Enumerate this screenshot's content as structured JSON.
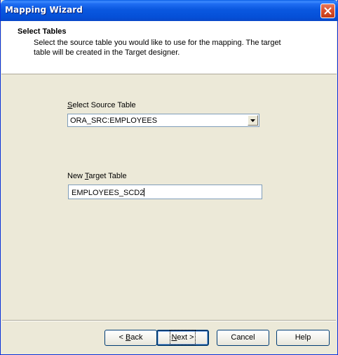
{
  "window": {
    "title": "Mapping Wizard"
  },
  "header": {
    "title": "Select Tables",
    "description": "Select the source table you would like to use for the mapping. The target table will be created in the Target designer."
  },
  "source": {
    "label_mnemonic": "S",
    "label_rest": "elect Source Table",
    "value": "ORA_SRC:EMPLOYEES"
  },
  "target": {
    "label_pre": "New ",
    "label_mnemonic": "T",
    "label_rest": "arget Table",
    "value": "EMPLOYEES_SCD2"
  },
  "buttons": {
    "back_pre": "< ",
    "back_mnemonic": "B",
    "back_rest": "ack",
    "next_mnemonic": "N",
    "next_rest": "ext >",
    "cancel": "Cancel",
    "help": "Help"
  },
  "icons": {
    "close": "close-icon",
    "dropdown": "chevron-down-icon"
  },
  "colors": {
    "titlebar": "#0a58e0",
    "close": "#d94e2b",
    "dialog": "#ece9d8"
  }
}
